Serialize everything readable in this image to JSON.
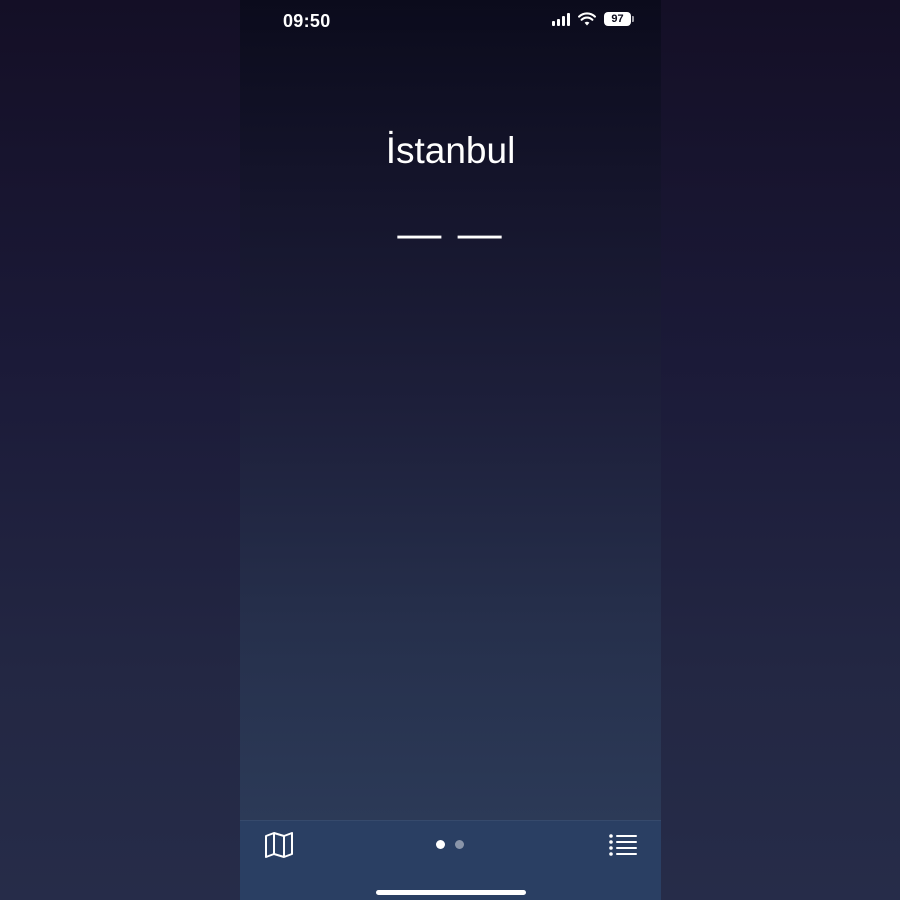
{
  "status_bar": {
    "time": "09:50",
    "battery": "97",
    "icons": [
      "signal-icon",
      "wifi-icon",
      "battery-icon"
    ]
  },
  "location": {
    "city": "İstanbul",
    "temperature": "— —"
  },
  "bottom_bar": {
    "icons": [
      "map-icon",
      "list-icon"
    ],
    "pages": [
      {
        "active": true
      },
      {
        "active": false
      }
    ]
  },
  "colors": {
    "bottom_bar_bg": "#2a3f63",
    "text": "#ffffff"
  }
}
